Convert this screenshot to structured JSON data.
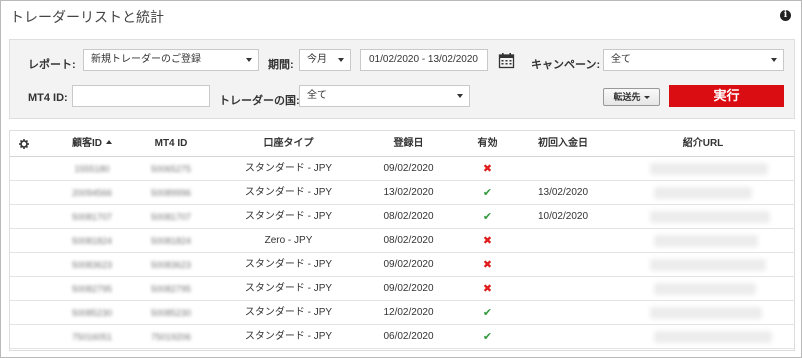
{
  "page": {
    "title": "トレーダーリストと統計"
  },
  "filters": {
    "report_label": "レポート:",
    "report_value": "新規トレーダーのご登録",
    "period_label": "期間:",
    "period_value": "今月",
    "date_range": "01/02/2020 - 13/02/2020",
    "campaign_label": "キャンペーン:",
    "campaign_value": "全て",
    "mt4id_label": "MT4 ID:",
    "mt4id_value": "",
    "country_label": "トレーダーの国:",
    "country_value": "全て",
    "forward_label": "転送先",
    "run_label": "実行"
  },
  "table": {
    "columns": [
      "顧客ID",
      "MT4 ID",
      "口座タイプ",
      "登録日",
      "有効",
      "初回入金日",
      "紹介URL"
    ],
    "sort_column": "顧客ID",
    "sort_direction": "asc",
    "rows": [
      {
        "client_id": "1555180",
        "mt4_id": "50065275",
        "account_type": "スタンダード - JPY",
        "reg_date": "09/02/2020",
        "active": false,
        "first_deposit": ""
      },
      {
        "client_id": "20094566",
        "mt4_id": "50089996",
        "account_type": "スタンダード - JPY",
        "reg_date": "13/02/2020",
        "active": true,
        "first_deposit": "13/02/2020"
      },
      {
        "client_id": "50081707",
        "mt4_id": "50081707",
        "account_type": "スタンダード - JPY",
        "reg_date": "08/02/2020",
        "active": true,
        "first_deposit": "10/02/2020"
      },
      {
        "client_id": "50081824",
        "mt4_id": "50081824",
        "account_type": "Zero - JPY",
        "reg_date": "08/02/2020",
        "active": false,
        "first_deposit": ""
      },
      {
        "client_id": "50083623",
        "mt4_id": "50083623",
        "account_type": "スタンダード - JPY",
        "reg_date": "09/02/2020",
        "active": false,
        "first_deposit": ""
      },
      {
        "client_id": "50082795",
        "mt4_id": "50082795",
        "account_type": "スタンダード - JPY",
        "reg_date": "09/02/2020",
        "active": false,
        "first_deposit": ""
      },
      {
        "client_id": "50085230",
        "mt4_id": "50085230",
        "account_type": "スタンダード - JPY",
        "reg_date": "12/02/2020",
        "active": true,
        "first_deposit": ""
      },
      {
        "client_id": "75016051",
        "mt4_id": "75019206",
        "account_type": "スタンダード - JPY",
        "reg_date": "06/02/2020",
        "active": true,
        "first_deposit": ""
      }
    ]
  },
  "colors": {
    "run_button": "#d90d12",
    "active_check": "#2f9b3a",
    "inactive_cross": "#e01b1b"
  },
  "icons": {
    "info": "info-icon",
    "settings": "gear-icon",
    "calendar": "calendar-icon",
    "sort": "sort-asc-icon"
  }
}
